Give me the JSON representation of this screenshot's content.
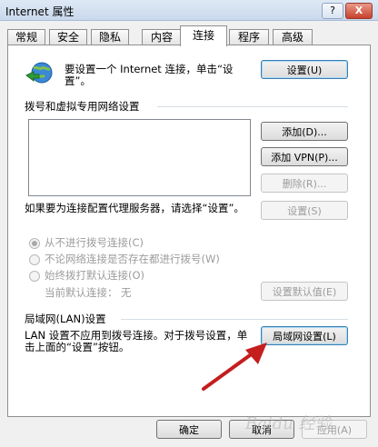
{
  "window": {
    "title": "Internet 属性",
    "help": "?",
    "close": "X"
  },
  "tabs": [
    "常规",
    "安全",
    "隐私",
    "内容",
    "连接",
    "程序",
    "高级"
  ],
  "setup": {
    "text": "要设置一个 Internet 连接，单击“设置”。",
    "button": "设置(U)"
  },
  "dialup": {
    "heading": "拨号和虚拟专用网络设置",
    "add": "添加(D)...",
    "add_vpn": "添加 VPN(P)...",
    "remove": "删除(R)...",
    "proxy_text": "如果要为连接配置代理服务器，请选择“设置”。",
    "settings": "设置(S)",
    "options": [
      "从不进行拨号连接(C)",
      "不论网络连接是否存在都进行拨号(W)",
      "始终拨打默认连接(O)"
    ],
    "current_label": "当前默认连接：",
    "current_value": "无",
    "set_default": "设置默认值(E)"
  },
  "lan": {
    "heading": "局域网(LAN)设置",
    "text": "LAN 设置不应用到拨号连接。对于拨号设置，单击上面的“设置”按钮。",
    "button": "局域网设置(L)"
  },
  "footer": {
    "ok": "确定",
    "cancel": "取消",
    "apply": "应用(A)"
  },
  "watermark": "Baidu 经验"
}
